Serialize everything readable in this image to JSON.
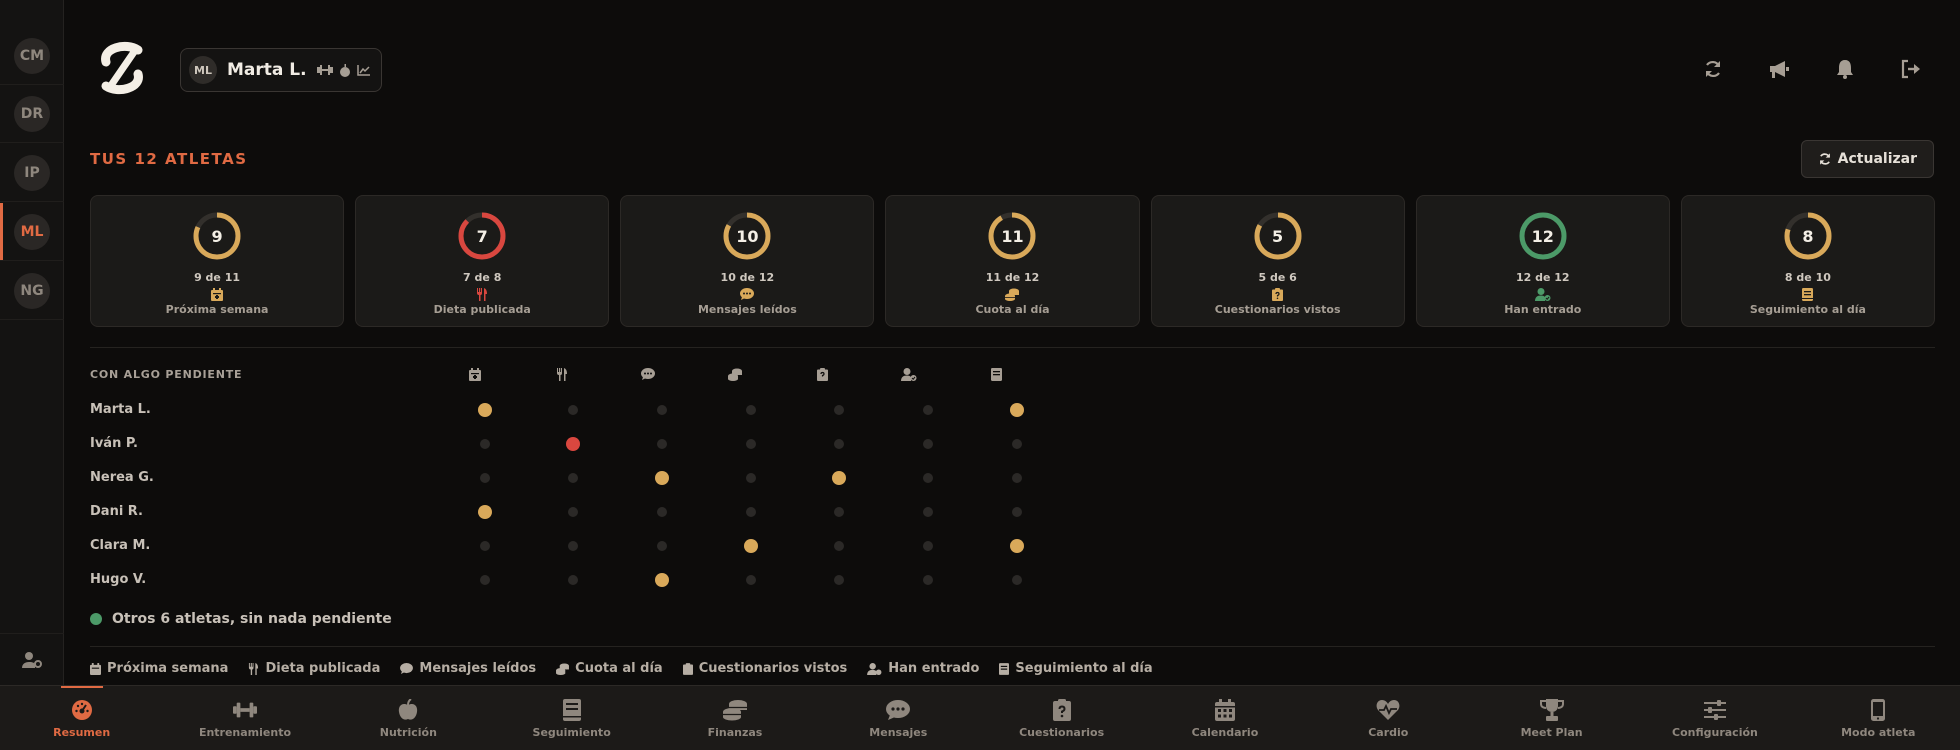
{
  "rail": {
    "items": [
      {
        "initials": "CM",
        "active": false
      },
      {
        "initials": "DR",
        "active": false
      },
      {
        "initials": "IP",
        "active": false
      },
      {
        "initials": "ML",
        "active": true
      },
      {
        "initials": "NG",
        "active": false
      }
    ]
  },
  "header": {
    "user_initials": "ML",
    "user_name": "Marta L.",
    "actions": [
      "sync-icon",
      "megaphone-icon",
      "bell-icon",
      "logout-icon"
    ]
  },
  "section_title": "TUS 12 ATLETAS",
  "refresh_label": "Actualizar",
  "stats": [
    {
      "value": "9",
      "fraction": "9 de 11",
      "label": "Próxima semana",
      "icon": "calendar-icon",
      "done": 9,
      "total": 11,
      "color": "#d9a95a"
    },
    {
      "value": "7",
      "fraction": "7 de 8",
      "label": "Dieta publicada",
      "icon": "utensils-icon",
      "done": 7,
      "total": 8,
      "color": "#d9473f"
    },
    {
      "value": "10",
      "fraction": "10 de 12",
      "label": "Mensajes leídos",
      "icon": "chat-icon",
      "done": 10,
      "total": 12,
      "color": "#d9a95a"
    },
    {
      "value": "11",
      "fraction": "11 de 12",
      "label": "Cuota al día",
      "icon": "coins-icon",
      "done": 11,
      "total": 12,
      "color": "#d9a95a"
    },
    {
      "value": "5",
      "fraction": "5 de 6",
      "label": "Cuestionarios vistos",
      "icon": "clipboard-icon",
      "done": 5,
      "total": 6,
      "color": "#d9a95a"
    },
    {
      "value": "12",
      "fraction": "12 de 12",
      "label": "Han entrado",
      "icon": "user-check-icon",
      "done": 12,
      "total": 12,
      "color": "#4c9a68"
    },
    {
      "value": "8",
      "fraction": "8 de 10",
      "label": "Seguimiento al día",
      "icon": "book-icon",
      "done": 8,
      "total": 10,
      "color": "#d9a95a"
    }
  ],
  "pending": {
    "title": "CON ALGO PENDIENTE",
    "columns": [
      "calendar-icon",
      "utensils-icon",
      "chat-icon",
      "coins-icon",
      "clipboard-icon",
      "user-check-icon",
      "book-icon"
    ],
    "rows": [
      {
        "name": "Marta L.",
        "status": [
          "y",
          "-",
          "-",
          "-",
          "-",
          "-",
          "y"
        ]
      },
      {
        "name": "Iván P.",
        "status": [
          "-",
          "r",
          "-",
          "-",
          "-",
          "-",
          "-"
        ]
      },
      {
        "name": "Nerea G.",
        "status": [
          "-",
          "-",
          "y",
          "-",
          "y",
          "-",
          "-"
        ]
      },
      {
        "name": "Dani R.",
        "status": [
          "y",
          "-",
          "-",
          "-",
          "-",
          "-",
          "-"
        ]
      },
      {
        "name": "Clara M.",
        "status": [
          "-",
          "-",
          "-",
          "y",
          "-",
          "-",
          "y"
        ]
      },
      {
        "name": "Hugo V.",
        "status": [
          "-",
          "-",
          "y",
          "-",
          "-",
          "-",
          "-"
        ]
      }
    ],
    "others": "Otros 6 atletas, sin nada pendiente"
  },
  "legend": [
    {
      "icon": "calendar-icon",
      "label": "Próxima semana"
    },
    {
      "icon": "utensils-icon",
      "label": "Dieta publicada"
    },
    {
      "icon": "chat-icon",
      "label": "Mensajes leídos"
    },
    {
      "icon": "coins-icon",
      "label": "Cuota al día"
    },
    {
      "icon": "clipboard-icon",
      "label": "Cuestionarios vistos"
    },
    {
      "icon": "user-check-icon",
      "label": "Han entrado"
    },
    {
      "icon": "book-icon",
      "label": "Seguimiento al día"
    }
  ],
  "nav": [
    {
      "label": "Resumen",
      "icon": "dashboard-icon",
      "active": true
    },
    {
      "label": "Entrenamiento",
      "icon": "dumbbell-icon",
      "active": false
    },
    {
      "label": "Nutrición",
      "icon": "apple-icon",
      "active": false
    },
    {
      "label": "Seguimiento",
      "icon": "book-icon",
      "active": false
    },
    {
      "label": "Finanzas",
      "icon": "coins-icon",
      "active": false
    },
    {
      "label": "Mensajes",
      "icon": "chat-icon",
      "active": false
    },
    {
      "label": "Cuestionarios",
      "icon": "clipboard-icon",
      "active": false
    },
    {
      "label": "Calendario",
      "icon": "calendar-grid-icon",
      "active": false
    },
    {
      "label": "Cardio",
      "icon": "heart-pulse-icon",
      "active": false
    },
    {
      "label": "Meet Plan",
      "icon": "trophy-icon",
      "active": false
    },
    {
      "label": "Configuración",
      "icon": "sliders-icon",
      "active": false
    },
    {
      "label": "Modo atleta",
      "icon": "phone-icon",
      "active": false
    }
  ],
  "colors": {
    "accent": "#e06a43",
    "amber": "#d9a95a",
    "red": "#d9473f",
    "green": "#4c9a68"
  }
}
